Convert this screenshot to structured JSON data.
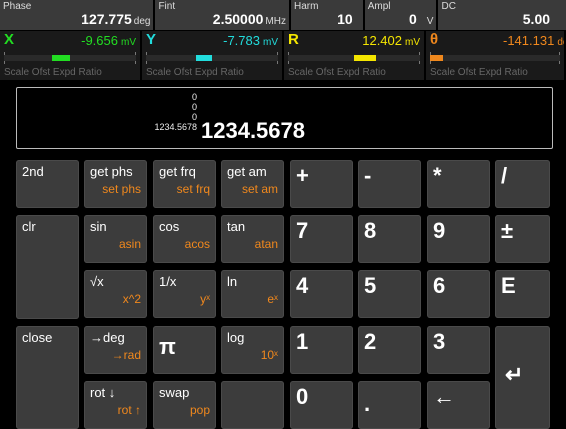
{
  "top": {
    "phase": {
      "label": "Phase",
      "value": "127.775",
      "unit": "deg"
    },
    "fint": {
      "label": "Fint",
      "value": "2.50000",
      "unit": "MHz"
    },
    "harm": {
      "label": "Harm",
      "value": "10"
    },
    "ampl": {
      "label": "Ampl",
      "value": "0",
      "unit": "V"
    },
    "dc": {
      "label": "DC",
      "value": "5.00"
    }
  },
  "channels": [
    {
      "name": "X",
      "value": "-9.656",
      "unit": "mV",
      "color": "#22dd22",
      "fill": 0.36
    },
    {
      "name": "Y",
      "value": "-7.783",
      "unit": "mV",
      "color": "#22dddd",
      "fill": 0.38
    },
    {
      "name": "R",
      "value": "12.402",
      "unit": "mV",
      "color": "#f5e600",
      "fill": 0.34
    },
    {
      "name": "θ",
      "value": "-141.131",
      "unit": "deg",
      "color": "#f0881d",
      "fill": 0.1
    }
  ],
  "scale_label": "Scale Ofst  Expd Ratio",
  "display": {
    "stack": [
      "0",
      "0",
      "0",
      "1234.5678"
    ],
    "result": "1234.5678"
  },
  "keys": {
    "k2nd": {
      "p": "2nd"
    },
    "getphs": {
      "p": "get phs",
      "s": "set phs"
    },
    "getfrq": {
      "p": "get frq",
      "s": "set frq"
    },
    "getam": {
      "p": "get am",
      "s": "set am"
    },
    "plus": {
      "p": "+"
    },
    "minus": {
      "p": "-"
    },
    "mult": {
      "p": "*"
    },
    "div": {
      "p": "/"
    },
    "clr": {
      "p": "clr"
    },
    "sin": {
      "p": "sin",
      "s": "asin"
    },
    "cos": {
      "p": "cos",
      "s": "acos"
    },
    "tan": {
      "p": "tan",
      "s": "atan"
    },
    "d7": {
      "p": "7"
    },
    "d8": {
      "p": "8"
    },
    "d9": {
      "p": "9"
    },
    "pm": {
      "p": "±"
    },
    "sqrt": {
      "p": "√x",
      "s": "x^2"
    },
    "recip": {
      "p": "1/x",
      "s": "yˣ"
    },
    "ln": {
      "p": "ln",
      "s": "eˣ"
    },
    "d4": {
      "p": "4"
    },
    "d5": {
      "p": "5"
    },
    "d6": {
      "p": "6"
    },
    "exp": {
      "p": "E"
    },
    "close": {
      "p": "close"
    },
    "todeg": {
      "p": "→deg",
      "s": "→rad"
    },
    "pi": {
      "p": "π"
    },
    "log": {
      "p": "log",
      "s": "10ˣ"
    },
    "d1": {
      "p": "1"
    },
    "d2": {
      "p": "2"
    },
    "d3": {
      "p": "3"
    },
    "enter": {
      "p": "↵"
    },
    "rot": {
      "p": "rot ↓",
      "s": "rot ↑"
    },
    "swap": {
      "p": "swap",
      "s": "pop"
    },
    "d0": {
      "p": "0"
    },
    "dot": {
      "p": "."
    },
    "back": {
      "p": "←"
    }
  }
}
